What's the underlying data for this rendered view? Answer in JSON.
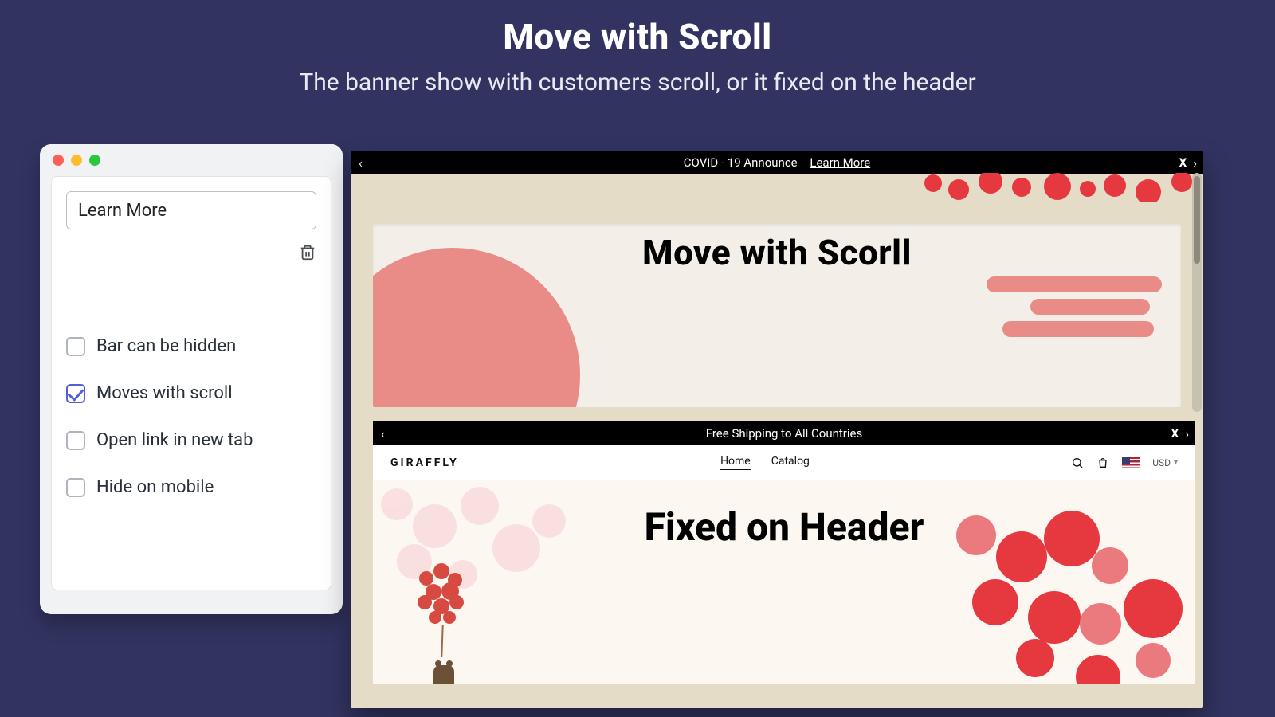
{
  "hero": {
    "title": "Move with Scroll",
    "subtitle": "The banner show with customers scroll, or it fixed on the header"
  },
  "settings": {
    "input_value": "Learn More",
    "checks": {
      "hidden": {
        "label": "Bar can be hidden",
        "checked": false
      },
      "scroll": {
        "label": "Moves with scroll",
        "checked": true
      },
      "newtab": {
        "label": "Open link in new tab",
        "checked": false
      },
      "mobile": {
        "label": "Hide on mobile",
        "checked": false
      }
    }
  },
  "previews": {
    "top_bar": {
      "text": "COVID - 19 Announce",
      "link": "Learn More",
      "close": "X"
    },
    "section1": {
      "heading": "Move with Scorll"
    },
    "mid_bar": {
      "text": "Free Shipping to All Countries",
      "close": "X"
    },
    "store_header": {
      "brand": "GIRAFFLY",
      "nav": {
        "home": "Home",
        "catalog": "Catalog"
      },
      "currency": "USD"
    },
    "section2": {
      "heading": "Fixed on Header"
    }
  },
  "colors": {
    "bg": "#323360",
    "accent_pink": "#e98b87",
    "accent_red": "#e6393f",
    "checkbox_active": "#5261d8"
  }
}
